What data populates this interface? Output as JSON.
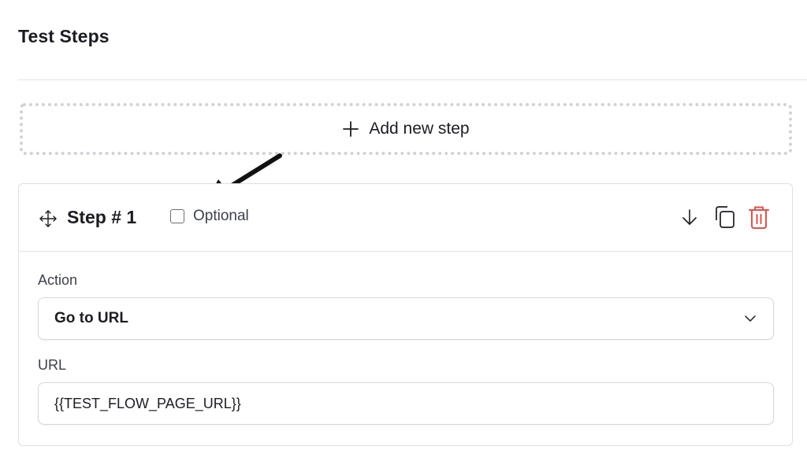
{
  "section": {
    "title": "Test Steps"
  },
  "add_step": {
    "label": "Add new step",
    "icon": "plus-icon"
  },
  "step": {
    "title": "Step # 1",
    "optional_label": "Optional",
    "optional_checked": false,
    "icons": [
      "drag-move-icon",
      "arrow-down-icon",
      "duplicate-icon",
      "trash-icon"
    ],
    "action": {
      "label": "Action",
      "value": "Go to URL"
    },
    "url": {
      "label": "URL",
      "value": "{{TEST_FLOW_PAGE_URL}}"
    }
  },
  "colors": {
    "text": "#1b1d22",
    "danger": "#d9534f",
    "border": "#dcdfe3",
    "dotted_border": "#cfd2d6"
  }
}
